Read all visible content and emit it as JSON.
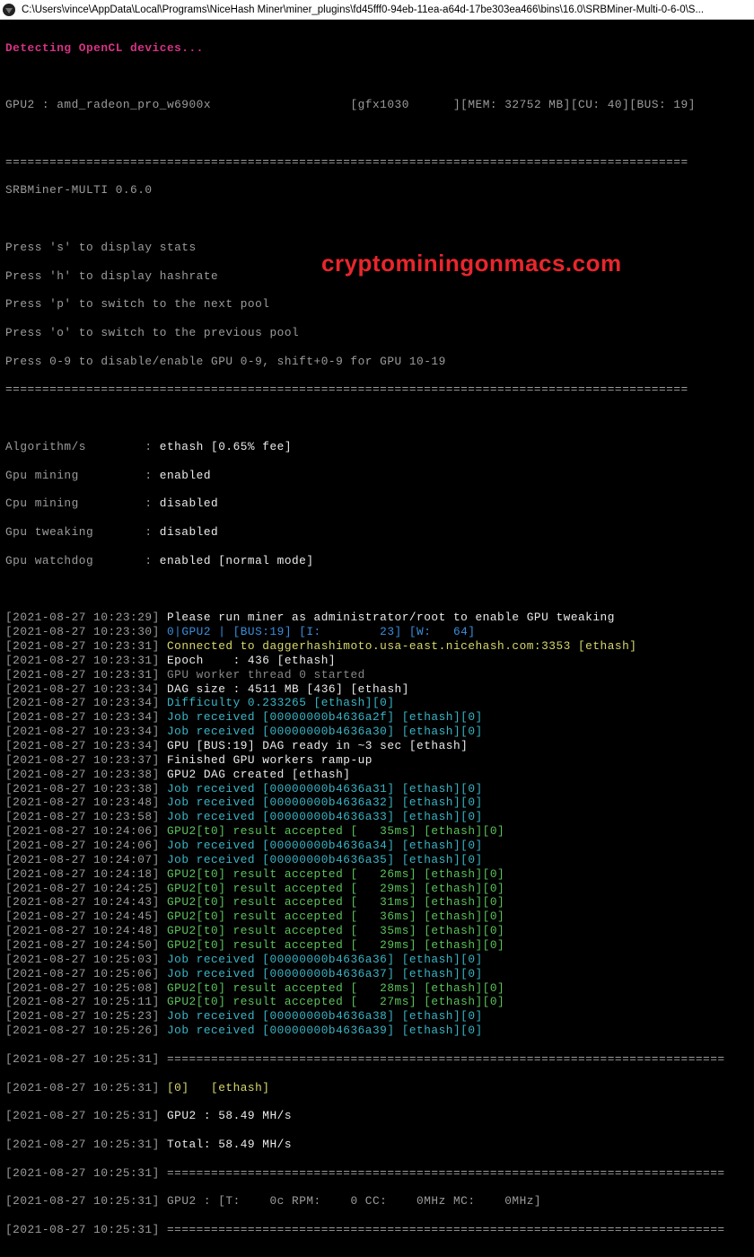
{
  "titlebar": {
    "path": "C:\\Users\\vince\\AppData\\Local\\Programs\\NiceHash Miner\\miner_plugins\\fd45fff0-94eb-11ea-a64d-17be303ea466\\bins\\16.0\\SRBMiner-Multi-0-6-0\\S..."
  },
  "detect": "Detecting OpenCL devices...",
  "gpu_row": {
    "left": "GPU2 : amd_radeon_pro_w6900x",
    "gfx": "[gfx1030      ]",
    "mem": "[MEM: 32752 MB]",
    "cu": "[CU: 40]",
    "bus": "[BUS: 19]"
  },
  "divider": "=============================================================================================",
  "banner": "SRBMiner-MULTI 0.6.0",
  "help": [
    "Press 's' to display stats",
    "Press 'h' to display hashrate",
    "Press 'p' to switch to the next pool",
    "Press 'o' to switch to the previous pool",
    "Press 0-9 to disable/enable GPU 0-9, shift+0-9 for GPU 10-19"
  ],
  "config": [
    {
      "label": "Algorithm/s        :",
      "value": " ethash [0.65% fee]"
    },
    {
      "label": "Gpu mining         :",
      "value": " enabled"
    },
    {
      "label": "Cpu mining         :",
      "value": " disabled"
    },
    {
      "label": "Gpu tweaking       :",
      "value": " disabled"
    },
    {
      "label": "Gpu watchdog       :",
      "value": " enabled [normal mode]"
    }
  ],
  "watermark": "cryptominingonmacs.com",
  "log": [
    {
      "t": "[2021-08-27 10:23:29]",
      "cls": "white",
      "m": " Please run miner as administrator/root to enable GPU tweaking"
    },
    {
      "t": "[2021-08-27 10:23:30]",
      "cls": "blue",
      "m": " 0|GPU2 | [BUS:19] [I:        23] [W:   64]"
    },
    {
      "t": "[2021-08-27 10:23:31]",
      "cls": "yellow",
      "m": " Connected to daggerhashimoto.usa-east.nicehash.com:3353 [ethash]"
    },
    {
      "t": "[2021-08-27 10:23:31]",
      "cls": "white",
      "m": " Epoch    : 436 [ethash]"
    },
    {
      "t": "[2021-08-27 10:23:31]",
      "cls": "dim",
      "m": " GPU worker thread 0 started"
    },
    {
      "t": "[2021-08-27 10:23:34]",
      "cls": "white",
      "m": " DAG size : 4511 MB [436] [ethash]"
    },
    {
      "t": "[2021-08-27 10:23:34]",
      "cls": "cyan",
      "m": " Difficulty 0.233265 [ethash][0]"
    },
    {
      "t": "[2021-08-27 10:23:34]",
      "cls": "cyan",
      "m": " Job received [00000000b4636a2f] [ethash][0]"
    },
    {
      "t": "[2021-08-27 10:23:34]",
      "cls": "cyan",
      "m": " Job received [00000000b4636a30] [ethash][0]"
    },
    {
      "t": "[2021-08-27 10:23:34]",
      "cls": "white",
      "m": " GPU [BUS:19] DAG ready in ~3 sec [ethash]"
    },
    {
      "t": "[2021-08-27 10:23:37]",
      "cls": "white",
      "m": " Finished GPU workers ramp-up"
    },
    {
      "t": "[2021-08-27 10:23:38]",
      "cls": "white",
      "m": " GPU2 DAG created [ethash]"
    },
    {
      "t": "[2021-08-27 10:23:38]",
      "cls": "cyan",
      "m": " Job received [00000000b4636a31] [ethash][0]"
    },
    {
      "t": "[2021-08-27 10:23:48]",
      "cls": "cyan",
      "m": " Job received [00000000b4636a32] [ethash][0]"
    },
    {
      "t": "[2021-08-27 10:23:58]",
      "cls": "cyan",
      "m": " Job received [00000000b4636a33] [ethash][0]"
    },
    {
      "t": "[2021-08-27 10:24:06]",
      "cls": "green",
      "m": " GPU2[t0] result accepted [   35ms] [ethash][0]"
    },
    {
      "t": "[2021-08-27 10:24:06]",
      "cls": "cyan",
      "m": " Job received [00000000b4636a34] [ethash][0]"
    },
    {
      "t": "[2021-08-27 10:24:07]",
      "cls": "cyan",
      "m": " Job received [00000000b4636a35] [ethash][0]"
    },
    {
      "t": "[2021-08-27 10:24:18]",
      "cls": "green",
      "m": " GPU2[t0] result accepted [   26ms] [ethash][0]"
    },
    {
      "t": "[2021-08-27 10:24:25]",
      "cls": "green",
      "m": " GPU2[t0] result accepted [   29ms] [ethash][0]"
    },
    {
      "t": "[2021-08-27 10:24:43]",
      "cls": "green",
      "m": " GPU2[t0] result accepted [   31ms] [ethash][0]"
    },
    {
      "t": "[2021-08-27 10:24:45]",
      "cls": "green",
      "m": " GPU2[t0] result accepted [   36ms] [ethash][0]"
    },
    {
      "t": "[2021-08-27 10:24:48]",
      "cls": "green",
      "m": " GPU2[t0] result accepted [   35ms] [ethash][0]"
    },
    {
      "t": "[2021-08-27 10:24:50]",
      "cls": "green",
      "m": " GPU2[t0] result accepted [   29ms] [ethash][0]"
    },
    {
      "t": "[2021-08-27 10:25:03]",
      "cls": "cyan",
      "m": " Job received [00000000b4636a36] [ethash][0]"
    },
    {
      "t": "[2021-08-27 10:25:06]",
      "cls": "cyan",
      "m": " Job received [00000000b4636a37] [ethash][0]"
    },
    {
      "t": "[2021-08-27 10:25:08]",
      "cls": "green",
      "m": " GPU2[t0] result accepted [   28ms] [ethash][0]"
    },
    {
      "t": "[2021-08-27 10:25:11]",
      "cls": "green",
      "m": " GPU2[t0] result accepted [   27ms] [ethash][0]"
    },
    {
      "t": "[2021-08-27 10:25:23]",
      "cls": "cyan",
      "m": " Job received [00000000b4636a38] [ethash][0]"
    },
    {
      "t": "[2021-08-27 10:25:26]",
      "cls": "cyan",
      "m": " Job received [00000000b4636a39] [ethash][0]"
    }
  ],
  "footer": {
    "t1": "[2021-08-27 10:25:31]",
    "dash": " ============================================================================",
    "t2": "[2021-08-27 10:25:31]",
    "algo": " [0]   [ethash]",
    "t3": "[2021-08-27 10:25:31]",
    "g2": " GPU2 : 58.49 MH/s",
    "t4": "[2021-08-27 10:25:31]",
    "tot": " Total: 58.49 MH/s",
    "t5": "[2021-08-27 10:25:31]",
    "t6": "[2021-08-27 10:25:31]",
    "gpu_stats": " GPU2 : [T:    0c RPM:    0 CC:    0MHz MC:    0MHz]",
    "t7": "[2021-08-27 10:25:31]"
  }
}
